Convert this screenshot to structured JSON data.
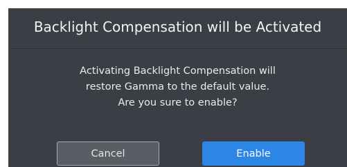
{
  "dialog": {
    "title": "Backlight Compensation will be Activated",
    "message_lines": [
      "Activating Backlight Compensation will",
      "restore Gamma to the default value.",
      "Are you sure to enable?"
    ],
    "cancel_label": "Cancel",
    "enable_label": "Enable"
  },
  "colors": {
    "dialog_background": "#3b3f45",
    "primary_button": "#2c86e6",
    "secondary_button": "#5a5e64"
  }
}
